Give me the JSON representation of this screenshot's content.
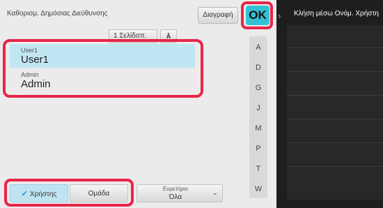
{
  "header": {
    "title": "Καθορισμ. Δημόσιας Διεύθυνσης",
    "delete_label": "Διαγραφή",
    "ok_label": "OK"
  },
  "pager": {
    "value": "1 Σελίδσπ.",
    "sort_label": "Ā"
  },
  "list": [
    {
      "small": "User1",
      "big": "User1"
    },
    {
      "small": "Admin",
      "big": "Admin"
    }
  ],
  "index_letters": [
    "A",
    "D",
    "G",
    "J",
    "M",
    "P",
    "T",
    "W"
  ],
  "bottom": {
    "user_tab": "Χρήστης",
    "group_tab": "Ομάδα",
    "index_label": "Ευρετήριο",
    "index_value": "Όλα"
  },
  "right_panel": {
    "title": "Κλήση μέσω Ονόμ. Χρήστη"
  },
  "colors": {
    "accent": "#34c1d6",
    "highlight": "#e8254a",
    "selected": "#c1e6f3"
  },
  "icons": {
    "check": "check-icon",
    "chevron_down": "chevron-down-icon",
    "chevron_right": "chevron-right-icon"
  }
}
